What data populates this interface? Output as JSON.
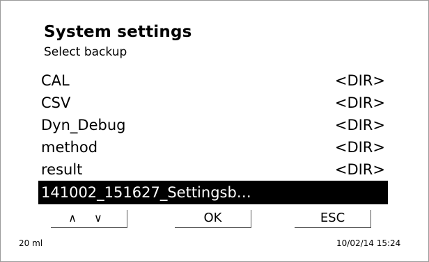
{
  "header": {
    "title": "System settings",
    "subtitle": "Select backup"
  },
  "list": {
    "items": [
      {
        "name": "CAL",
        "tag": "<DIR>"
      },
      {
        "name": "CSV",
        "tag": "<DIR>"
      },
      {
        "name": "Dyn_Debug",
        "tag": "<DIR>"
      },
      {
        "name": "method",
        "tag": "<DIR>"
      },
      {
        "name": "result",
        "tag": "<DIR>"
      },
      {
        "name": "141002_151627_Settingsb…",
        "tag": ""
      }
    ],
    "selected_index": 5
  },
  "softkeys": {
    "nav_label": "∧ ∨",
    "ok_label": "OK",
    "esc_label": "ESC"
  },
  "status": {
    "volume": "20 ml",
    "datetime": "10/02/14 15:24"
  },
  "colors": {
    "selection_bg": "#000000",
    "selection_fg": "#ffffff",
    "background": "#ffffff"
  }
}
